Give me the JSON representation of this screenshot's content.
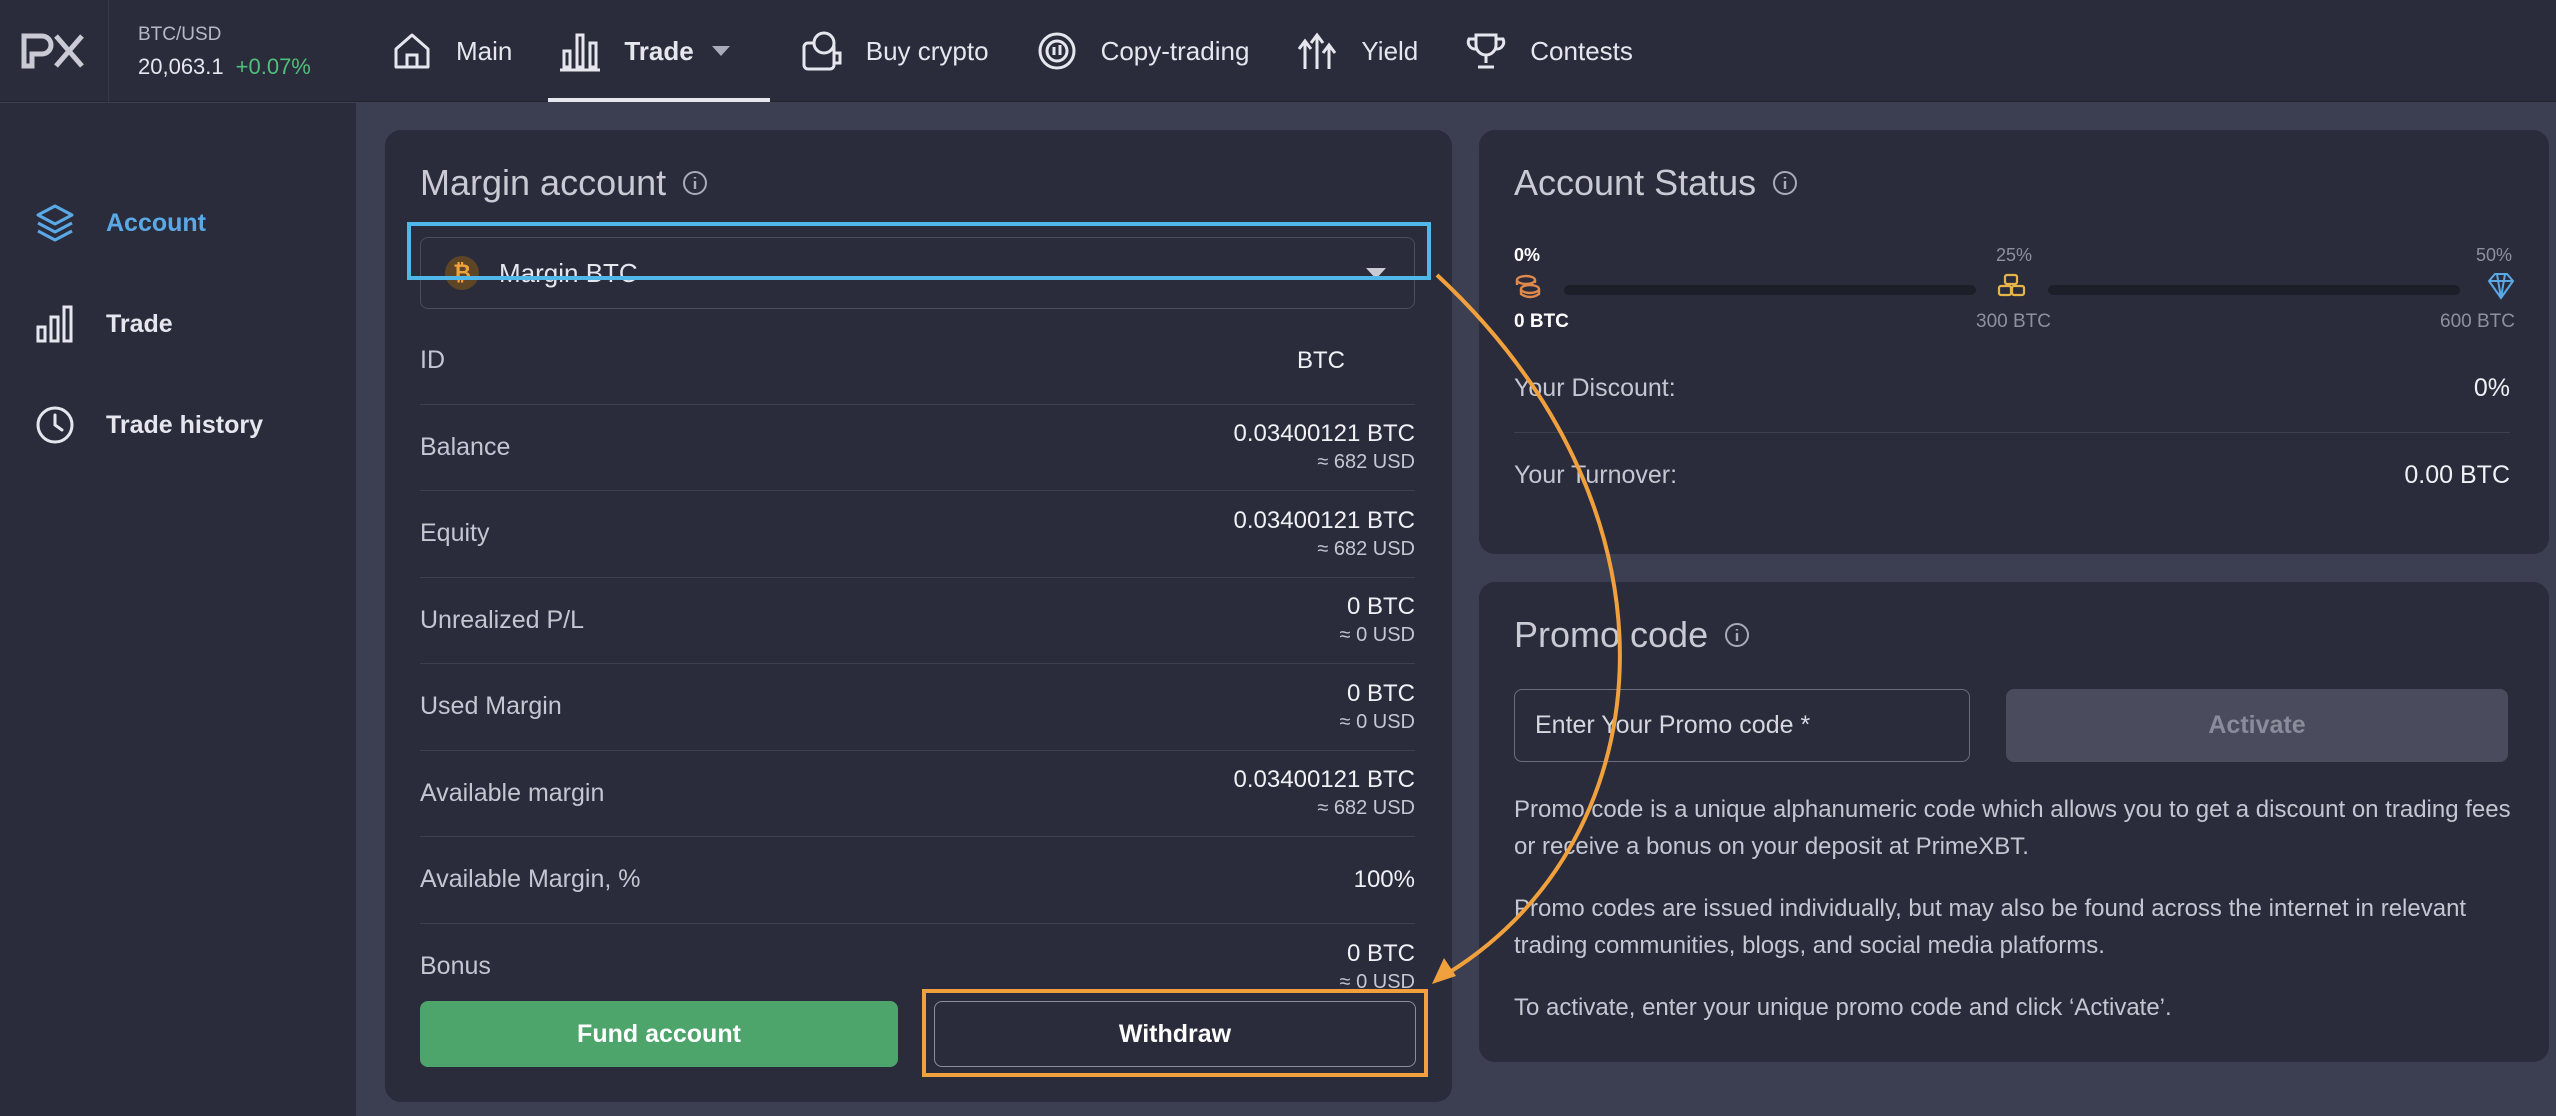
{
  "ticker": {
    "pair": "BTC/USD",
    "price": "20,063.1",
    "change": "+0.07%"
  },
  "nav": {
    "main": "Main",
    "trade": "Trade",
    "buy_crypto": "Buy crypto",
    "copy_trading": "Copy-trading",
    "yield": "Yield",
    "contests": "Contests"
  },
  "sidebar": {
    "account": "Account",
    "trade": "Trade",
    "trade_history": "Trade history"
  },
  "margin": {
    "title": "Margin account",
    "selected_account": "Margin BTC",
    "btc_symbol": "₿",
    "rows": [
      {
        "label": "ID",
        "value": "BTC",
        "sub": ""
      },
      {
        "label": "Balance",
        "value": "0.03400121 BTC",
        "sub": "≈ 682 USD"
      },
      {
        "label": "Equity",
        "value": "0.03400121 BTC",
        "sub": "≈ 682 USD"
      },
      {
        "label": "Unrealized P/L",
        "value": "0 BTC",
        "sub": "≈ 0 USD"
      },
      {
        "label": "Used Margin",
        "value": "0 BTC",
        "sub": "≈ 0 USD"
      },
      {
        "label": "Available margin",
        "value": "0.03400121 BTC",
        "sub": "≈ 682 USD"
      },
      {
        "label": "Available Margin, %",
        "value": "100%",
        "sub": ""
      },
      {
        "label": "Bonus",
        "value": "0 BTC",
        "sub": "≈ 0 USD"
      }
    ],
    "fund_button": "Fund account",
    "withdraw_button": "Withdraw"
  },
  "status": {
    "title": "Account Status",
    "levels": [
      {
        "pct": "0%",
        "amount": "0 BTC"
      },
      {
        "pct": "25%",
        "amount": "300 BTC"
      },
      {
        "pct": "50%",
        "amount": "600 BTC"
      }
    ],
    "discount_label": "Your Discount:",
    "discount_value": "0%",
    "turnover_label": "Your Turnover:",
    "turnover_value": "0.00 BTC"
  },
  "promo": {
    "title": "Promo code",
    "placeholder": "Enter Your Promo code *",
    "activate_button": "Activate",
    "text1": "Promo code is a unique alphanumeric code which allows you to get a discount on trading fees or receive a bonus on your deposit at PrimeXBT.",
    "text2": "Promo codes are issued individually, but may also be found across the internet in relevant trading communities, blogs, and social media platforms.",
    "text3": "To activate, enter your unique promo code and click ‘Activate’."
  },
  "colors": {
    "accent_blue": "#5aa9e6",
    "highlight_blue": "#4fb8e8",
    "highlight_orange": "#f0a03c",
    "positive_green": "#4fbf7a",
    "fund_green": "#4ea56c"
  },
  "icons": [
    "px-logo",
    "home-icon",
    "bar-chart-icon",
    "buy-crypto-icon",
    "copy-trading-icon",
    "yield-icon",
    "trophy-icon",
    "layers-icon",
    "clock-icon",
    "info-icon",
    "bitcoin-icon",
    "chevron-down-icon",
    "bronze-coins-icon",
    "gold-coins-icon",
    "diamond-icon"
  ]
}
